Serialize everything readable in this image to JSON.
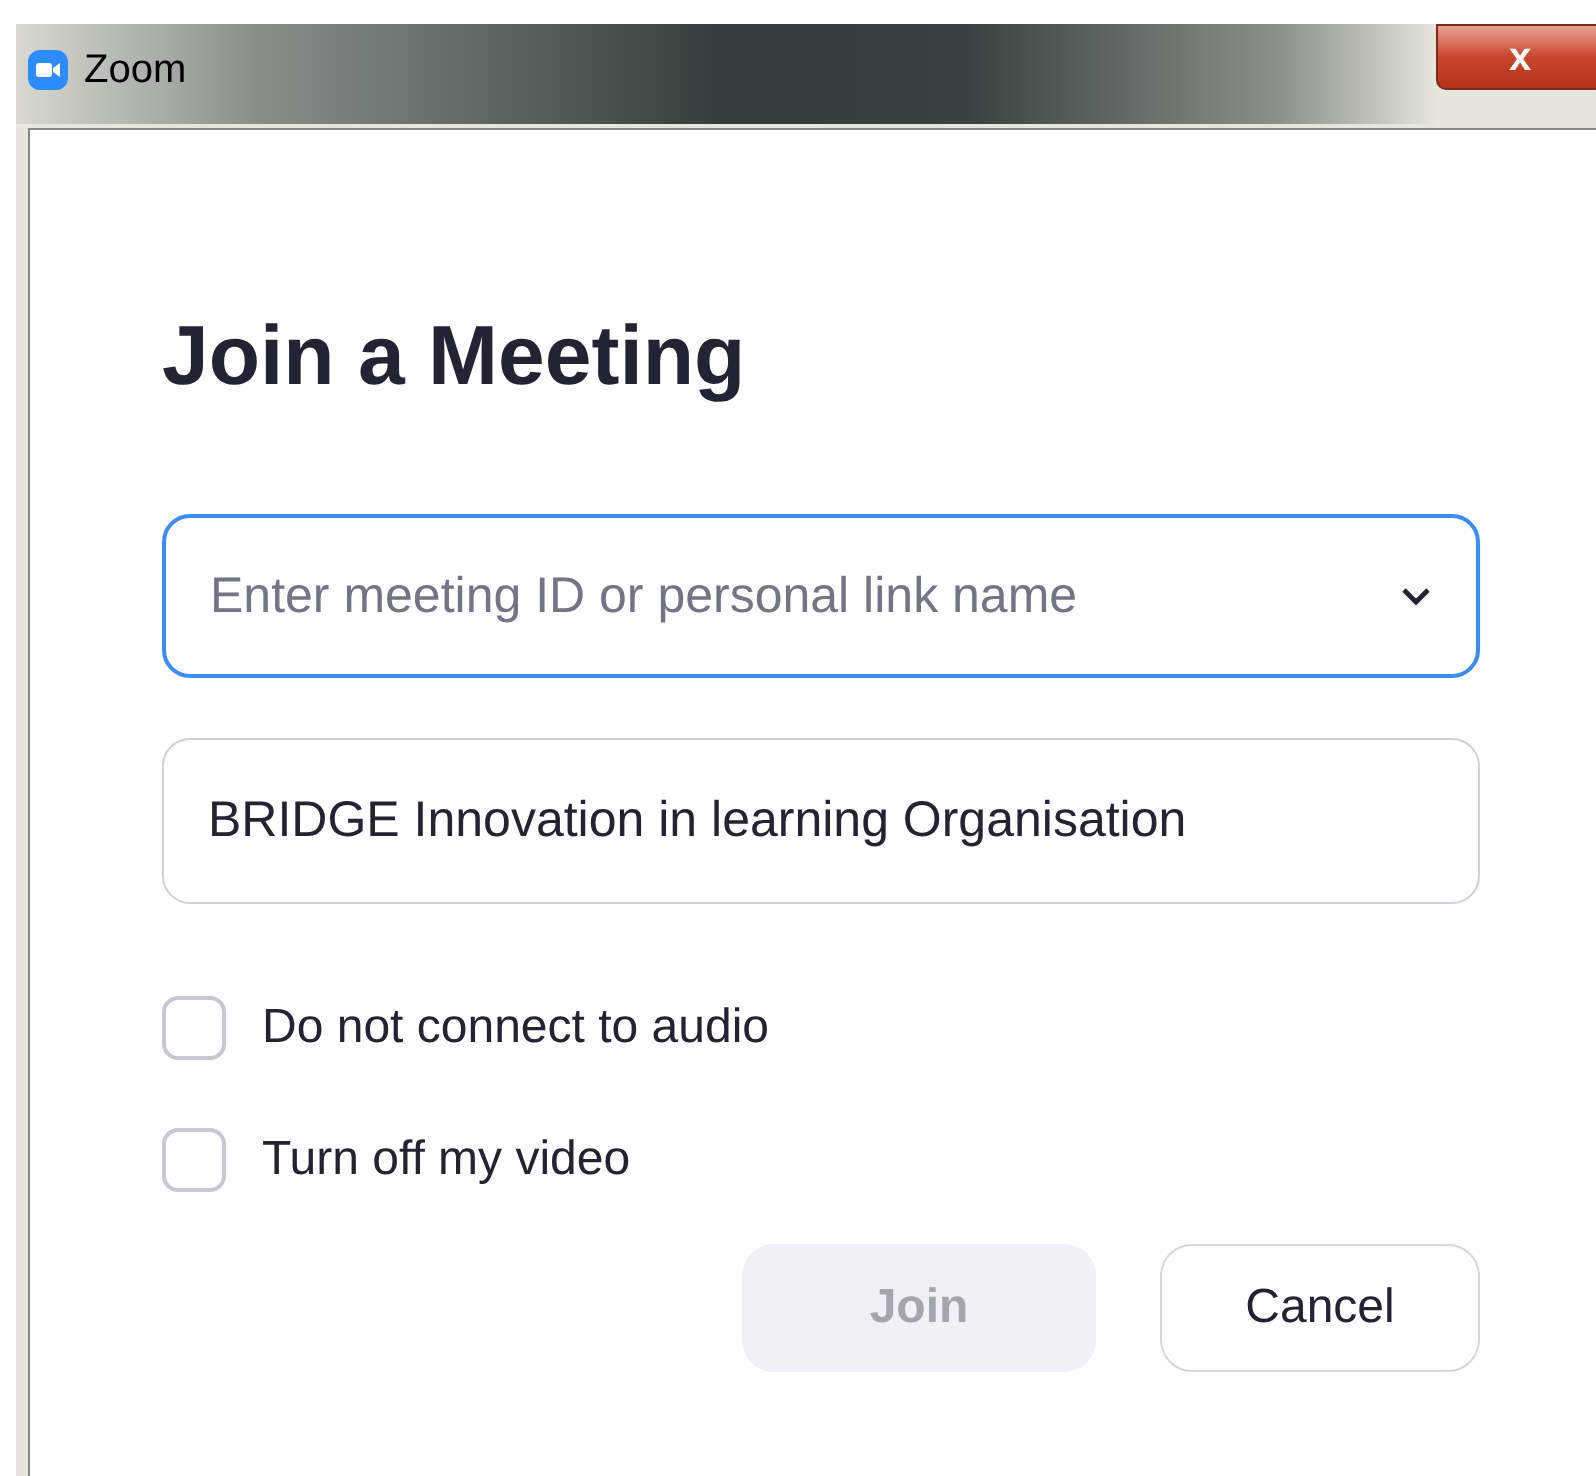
{
  "window": {
    "title": "Zoom",
    "close": "x"
  },
  "heading": "Join a Meeting",
  "meeting_id": {
    "placeholder": "Enter meeting ID or personal link name",
    "focused": true
  },
  "name": {
    "value": "BRIDGE Innovation in learning Organisation"
  },
  "options": [
    {
      "label": "Do not connect to audio",
      "checked": false
    },
    {
      "label": "Turn off my video",
      "checked": false
    }
  ],
  "buttons": [
    {
      "label": "Join",
      "disabled": true
    },
    {
      "label": "Cancel",
      "disabled": false
    }
  ]
}
